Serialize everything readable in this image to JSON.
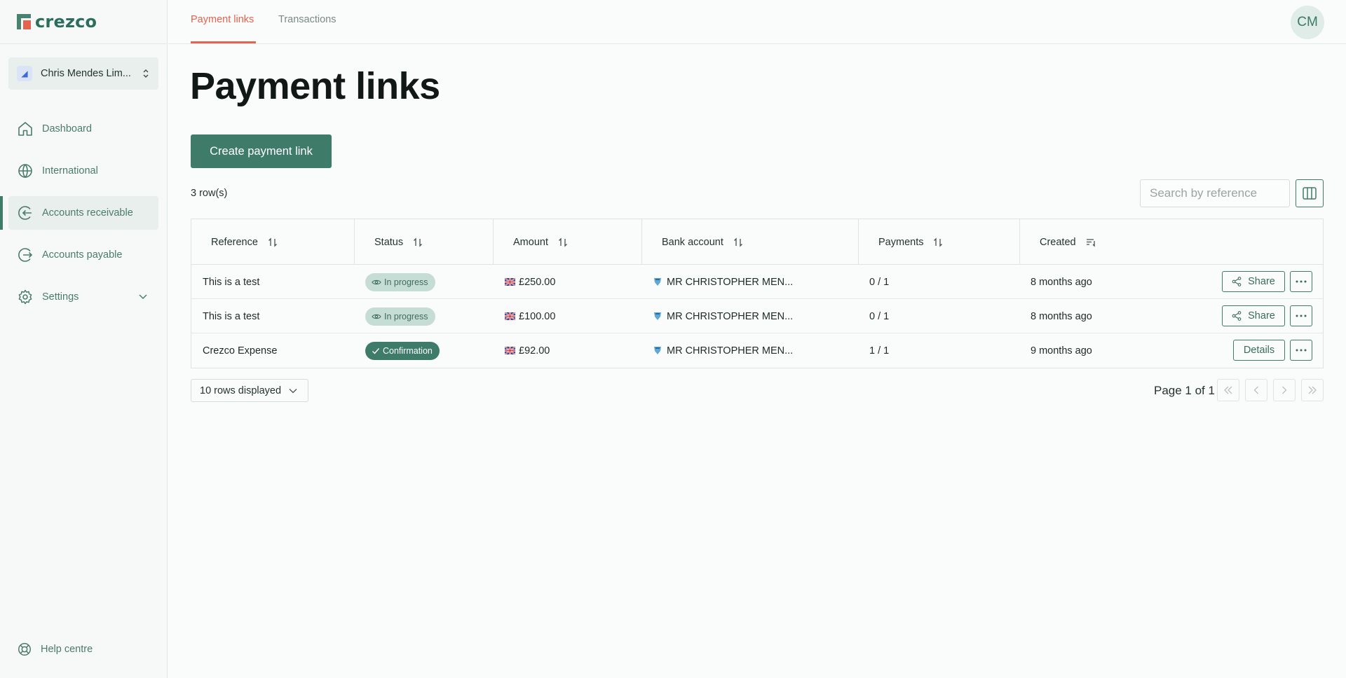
{
  "brand": {
    "name": "crezco"
  },
  "org": {
    "name": "Chris Mendes Lim..."
  },
  "nav": {
    "items": [
      {
        "label": "Dashboard"
      },
      {
        "label": "International"
      },
      {
        "label": "Accounts receivable"
      },
      {
        "label": "Accounts payable"
      },
      {
        "label": "Settings"
      }
    ],
    "help": "Help centre"
  },
  "tabs": [
    {
      "label": "Payment links",
      "active": true
    },
    {
      "label": "Transactions",
      "active": false
    }
  ],
  "user": {
    "initials": "CM"
  },
  "page": {
    "title": "Payment links",
    "create_label": "Create payment link",
    "row_count": "3 row(s)",
    "search_placeholder": "Search by reference"
  },
  "table": {
    "columns": [
      "Reference",
      "Status",
      "Amount",
      "Bank account",
      "Payments",
      "Created"
    ],
    "rows": [
      {
        "reference": "This is a test",
        "status": "In progress",
        "amount": "£250.00",
        "bank": "MR CHRISTOPHER MEN...",
        "payments": "0 / 1",
        "created": "8 months ago",
        "action": "Share"
      },
      {
        "reference": "This is a test",
        "status": "In progress",
        "amount": "£100.00",
        "bank": "MR CHRISTOPHER MEN...",
        "payments": "0 / 1",
        "created": "8 months ago",
        "action": "Share"
      },
      {
        "reference": "Crezco Expense",
        "status": "Confirmation",
        "amount": "£92.00",
        "bank": "MR CHRISTOPHER MEN...",
        "payments": "1 / 1",
        "created": "9 months ago",
        "action": "Details"
      }
    ]
  },
  "pagination": {
    "rows_displayed": "10 rows displayed",
    "page_info": "Page 1 of 1"
  },
  "colors": {
    "primary": "#3e7c69",
    "accent": "#e4624e",
    "badge_progress_bg": "#c6ddd5"
  },
  "icons": {
    "nav": [
      "home-icon",
      "globe-icon",
      "arrow-in-circle-icon",
      "arrow-out-circle-icon",
      "gear-icon"
    ],
    "help": "lifebuoy-icon"
  }
}
